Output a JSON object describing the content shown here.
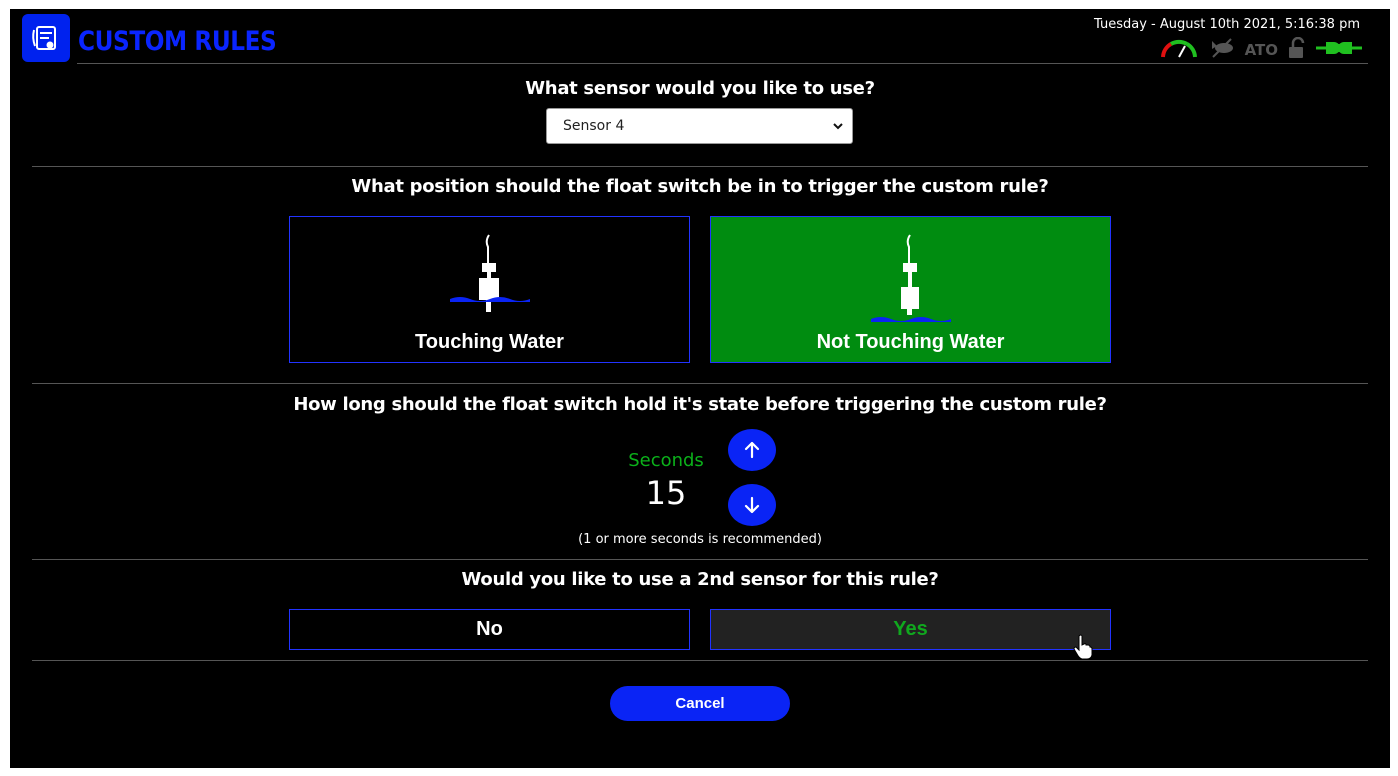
{
  "header": {
    "title": "CUSTOM RULES",
    "datetime": "Tuesday - August 10th 2021, 5:16:38 pm",
    "ato_label": "ATO",
    "icons": [
      "gauge-icon",
      "fish-icon",
      "unlock-icon",
      "plug-icon",
      "rules-logo-icon"
    ],
    "colors": {
      "accent": "#0a24f5",
      "selected": "#008c10",
      "green_text": "#0bb01a"
    }
  },
  "sensor": {
    "question": "What sensor would you like to use?",
    "selected": "Sensor 4"
  },
  "position": {
    "question": "What position should the float switch be in to trigger the custom rule?",
    "options": [
      {
        "label": "Touching Water",
        "selected": false
      },
      {
        "label": "Not Touching Water",
        "selected": true
      }
    ]
  },
  "hold": {
    "question": "How long should the float switch hold it's state before triggering the custom rule?",
    "unit_label": "Seconds",
    "value": "15",
    "hint": "(1 or more seconds is recommended)"
  },
  "second_sensor": {
    "question": "Would you like to use a 2nd sensor for this rule?",
    "no_label": "No",
    "yes_label": "Yes"
  },
  "footer": {
    "cancel_label": "Cancel"
  }
}
